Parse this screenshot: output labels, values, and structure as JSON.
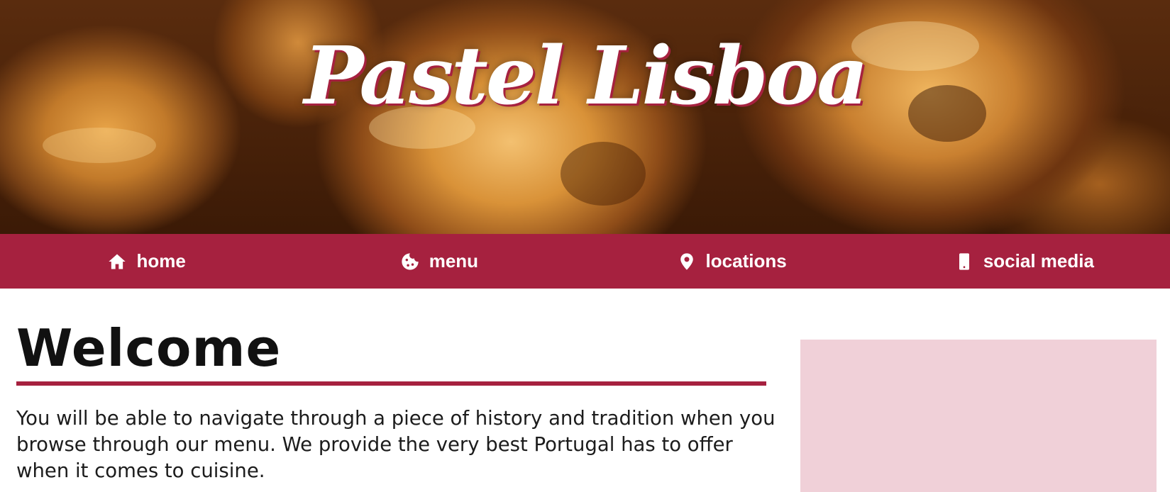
{
  "header": {
    "title": "Pastel Lisboa"
  },
  "nav": {
    "items": [
      {
        "label": "home",
        "icon": "home-icon"
      },
      {
        "label": "menu",
        "icon": "cookie-icon"
      },
      {
        "label": "locations",
        "icon": "map-pin-icon"
      },
      {
        "label": "social media",
        "icon": "mobile-phone-icon"
      }
    ]
  },
  "main": {
    "heading": "Welcome",
    "intro": "You will be able to navigate through a piece of history and tradition when you browse through our menu. We provide the very best Portugal has to offer when it comes to cuisine."
  },
  "colors": {
    "brand": "#a6213f",
    "sidebar_panel": "#f0d0d8",
    "text": "#111111"
  }
}
